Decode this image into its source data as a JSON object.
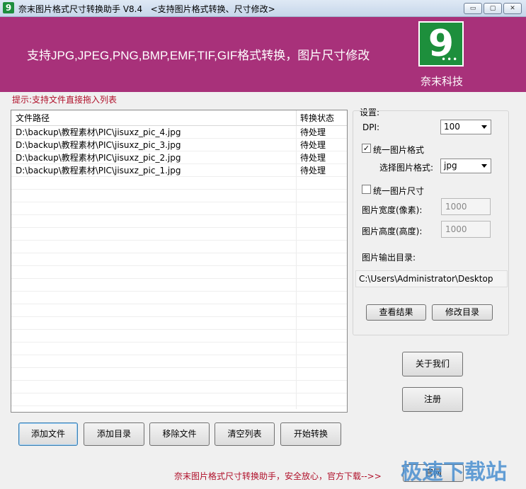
{
  "window": {
    "title": "奈末图片格式尺寸转换助手 V8.4",
    "subtitle": "<支持图片格式转换、尺寸修改>",
    "app_icon_glyph": "9",
    "controls": {
      "minimize": "▭",
      "restore": "▢",
      "close": "✕"
    }
  },
  "banner": {
    "slogan": "支持JPG,JPEG,PNG,BMP,EMF,TIF,GIF格式转换，图片尺寸修改",
    "logo_glyph": "9",
    "logo_dots": "•••",
    "logo_caption": "奈末科技",
    "color": "#a8317a"
  },
  "hint": "提示:支持文件直接拖入列表",
  "file_list": {
    "headers": {
      "path": "文件路径",
      "status": "转换状态"
    },
    "rows": [
      {
        "path": "D:\\backup\\教程素材\\PIC\\jisuxz_pic_4.jpg",
        "status": "待处理"
      },
      {
        "path": "D:\\backup\\教程素材\\PIC\\jisuxz_pic_3.jpg",
        "status": "待处理"
      },
      {
        "path": "D:\\backup\\教程素材\\PIC\\jisuxz_pic_2.jpg",
        "status": "待处理"
      },
      {
        "path": "D:\\backup\\教程素材\\PIC\\jisuxz_pic_1.jpg",
        "status": "待处理"
      }
    ]
  },
  "settings": {
    "group_label": "设置:",
    "dpi_label": "DPI:",
    "dpi_value": "100",
    "unify_format_label": "统一图片格式",
    "unify_format_checked": "✓",
    "select_format_label": "选择图片格式:",
    "format_value": "jpg",
    "unify_size_label": "统一图片尺寸",
    "width_label": "图片宽度(像素):",
    "width_value": "1000",
    "height_label": "图片高度(高度):",
    "height_value": "1000",
    "output_dir_label": "图片输出目录:",
    "output_dir_value": "C:\\Users\\Administrator\\Desktop",
    "view_result_button": "查看结果",
    "change_dir_button": "修改目录"
  },
  "side_buttons": {
    "about": "关于我们",
    "register": "注册"
  },
  "bottom_buttons": {
    "add_file": "添加文件",
    "add_dir": "添加目录",
    "remove_file": "移除文件",
    "clear_list": "清空列表",
    "start_convert": "开始转换"
  },
  "footer": {
    "text": "奈末图片格式尺寸转换助手，安全放心，官方下载-->>",
    "button": "官网",
    "watermark": "极速下载站"
  }
}
